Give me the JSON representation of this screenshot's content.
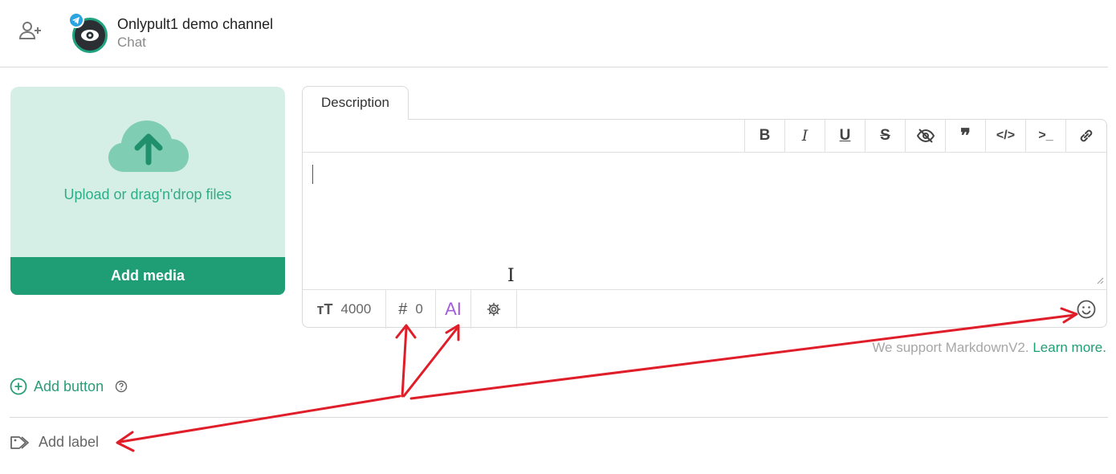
{
  "header": {
    "channel_name": "Onlypult1 demo channel",
    "channel_type": "Chat"
  },
  "upload": {
    "text": "Upload or drag'n'drop files",
    "add_media_label": "Add media"
  },
  "editor": {
    "tab_label": "Description",
    "format_buttons": [
      "bold",
      "italic",
      "underline",
      "strikethrough",
      "spoiler",
      "quote",
      "code",
      "pre",
      "link"
    ],
    "char_limit": "4000",
    "hashtag_count": "0",
    "ai_label": "AI"
  },
  "markdown_note": {
    "text": "We support MarkdownV2.",
    "link": "Learn more."
  },
  "actions": {
    "add_button_label": "Add button",
    "add_label_label": "Add label"
  },
  "colors": {
    "accent": "#1f9d75",
    "upload_bg": "#d6efe6",
    "annotation": "#e01e2a",
    "ai": "#a25ddc"
  }
}
